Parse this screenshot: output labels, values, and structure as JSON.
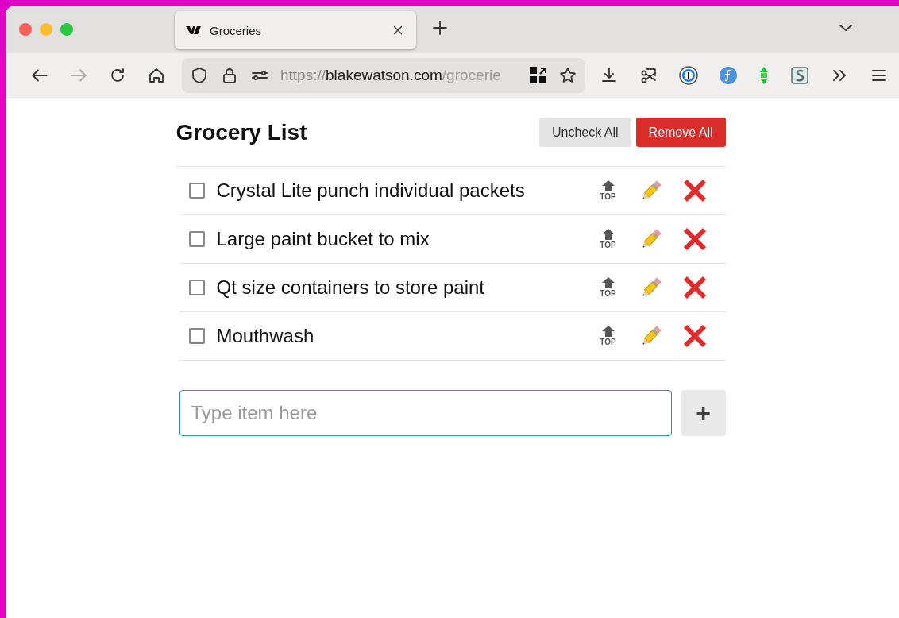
{
  "browser": {
    "tabs": [
      {
        "title": "Groceries",
        "selected": true
      }
    ],
    "address": {
      "scheme": "https://",
      "host": "blakewatson.com",
      "path": "/grocerie"
    }
  },
  "page": {
    "title": "Grocery List",
    "buttons": [
      {
        "label": "Uncheck All",
        "kind": "neutral"
      },
      {
        "label": "Remove All",
        "kind": "danger"
      }
    ],
    "items": [
      {
        "text": "Crystal Lite punch individual packets",
        "checked": false,
        "top_label": "TOP"
      },
      {
        "text": "Large paint bucket to mix",
        "checked": false,
        "top_label": "TOP"
      },
      {
        "text": "Qt size containers to store paint",
        "checked": false,
        "top_label": "TOP"
      },
      {
        "text": "Mouthwash",
        "checked": false,
        "top_label": "TOP"
      }
    ],
    "new_item": {
      "placeholder": "Type item here",
      "add_symbol": "+"
    }
  }
}
